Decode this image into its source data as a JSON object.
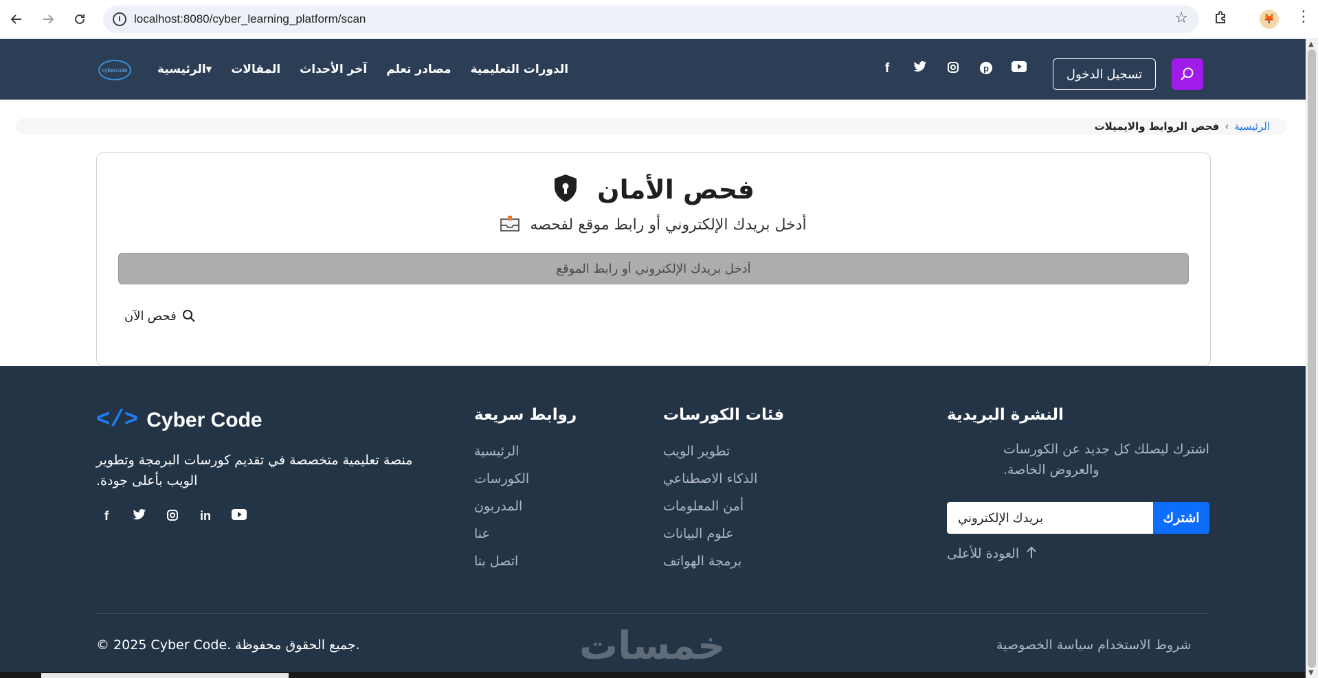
{
  "browser": {
    "url": "localhost:8080/cyber_learning_platform/scan"
  },
  "header": {
    "logo_text": "cybercode",
    "nav": [
      {
        "label": "الرئيسية▾"
      },
      {
        "label": "المقالات"
      },
      {
        "label": "آخر الأحداث"
      },
      {
        "label": "مصادر تعلم"
      },
      {
        "label": "الدورات التعليمية"
      }
    ],
    "login_label": "تسجيل الدخول"
  },
  "breadcrumb": {
    "home": "الرئيسية",
    "separator": "›",
    "current": "فحص الروابط والايميلات"
  },
  "scan": {
    "title": "فحص الأمان",
    "subtitle": "أدخل بريدك الإلكتروني أو رابط موقع لفحصه",
    "input_placeholder": "أدخل بريدك الإلكتروني أو رابط الموقع",
    "button_label": "فحص الآن"
  },
  "footer": {
    "brand_name": "Cyber Code",
    "brand_icon": "</>",
    "description": "منصة تعليمية متخصصة في تقديم كورسات البرمجة وتطوير الويب بأعلى جودة.",
    "quick_links": {
      "title": "روابط سريعة",
      "items": [
        "الرئيسية",
        "الكورسات",
        "المدربون",
        "عنا",
        "اتصل بنا"
      ]
    },
    "categories": {
      "title": "فئات الكورسات",
      "items": [
        "تطوير الويب",
        "الذكاء الاصطناعي",
        "أمن المعلومات",
        "علوم البيانات",
        "برمجة الهواتف"
      ]
    },
    "newsletter": {
      "title": "النشرة البريدية",
      "description": "اشترك ليصلك كل جديد عن الكورسات والعروض الخاصة.",
      "input_placeholder": "بريدك الإلكتروني",
      "subscribe_label": "اشترك",
      "back_to_top": "العودة للأعلى"
    },
    "copyright": "© 2025 Cyber Code. جميع الحقوق محفوظة.",
    "watermark": "خمسات",
    "terms": "شروط الاستخدام",
    "privacy": "سياسة الخصوصية"
  },
  "colors": {
    "header_bg": "#2c3e56",
    "footer_bg": "#243447",
    "search_accent": "#a11ce8",
    "subscribe_blue": "#0d6efd",
    "link_blue": "#1a73e8"
  }
}
